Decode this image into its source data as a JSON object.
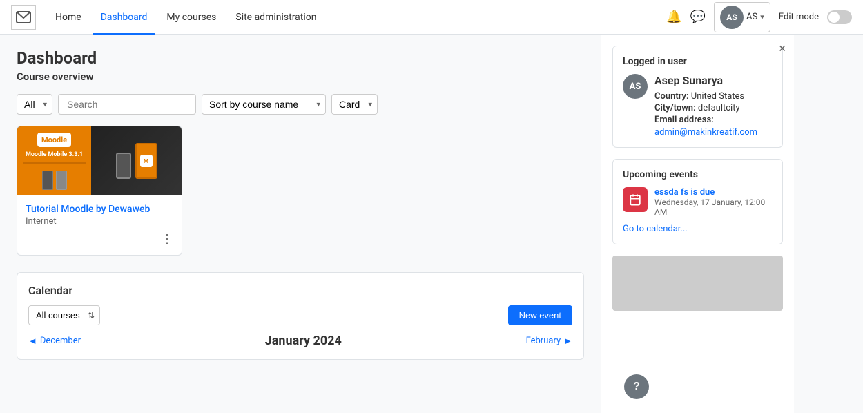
{
  "topnav": {
    "links": [
      "Home",
      "Dashboard",
      "My courses",
      "Site administration"
    ],
    "active_link": "Dashboard",
    "user_initials": "AS",
    "edit_mode_label": "Edit mode"
  },
  "dashboard": {
    "page_title": "Dashboard",
    "section_title": "Course overview",
    "filter": {
      "all_label": "All",
      "search_placeholder": "Search",
      "sort_label": "Sort by course name",
      "view_label": "Card"
    }
  },
  "courses": [
    {
      "title": "Tutorial Moodle by Dewaweb",
      "category": "Internet",
      "img_title": "Moodle Mobile 3.3.1"
    }
  ],
  "calendar": {
    "title": "Calendar",
    "filter_options": [
      "All courses"
    ],
    "new_event_label": "New event",
    "prev_month": "December",
    "current_month": "January 2024",
    "next_month": "February"
  },
  "sidebar": {
    "close_label": "×",
    "logged_in_title": "Logged in user",
    "user_initials": "AS",
    "user_name": "Asep Sunarya",
    "country_label": "Country:",
    "country_value": "United States",
    "city_label": "City/town:",
    "city_value": "defaultcity",
    "email_label": "Email address:",
    "email_value": "admin@makinkreatif.com",
    "upcoming_title": "Upcoming events",
    "event_name": "essda fs is due",
    "event_date": "Wednesday, 17 January, 12:00 AM",
    "go_to_calendar": "Go to calendar..."
  },
  "help": {
    "label": "?"
  }
}
